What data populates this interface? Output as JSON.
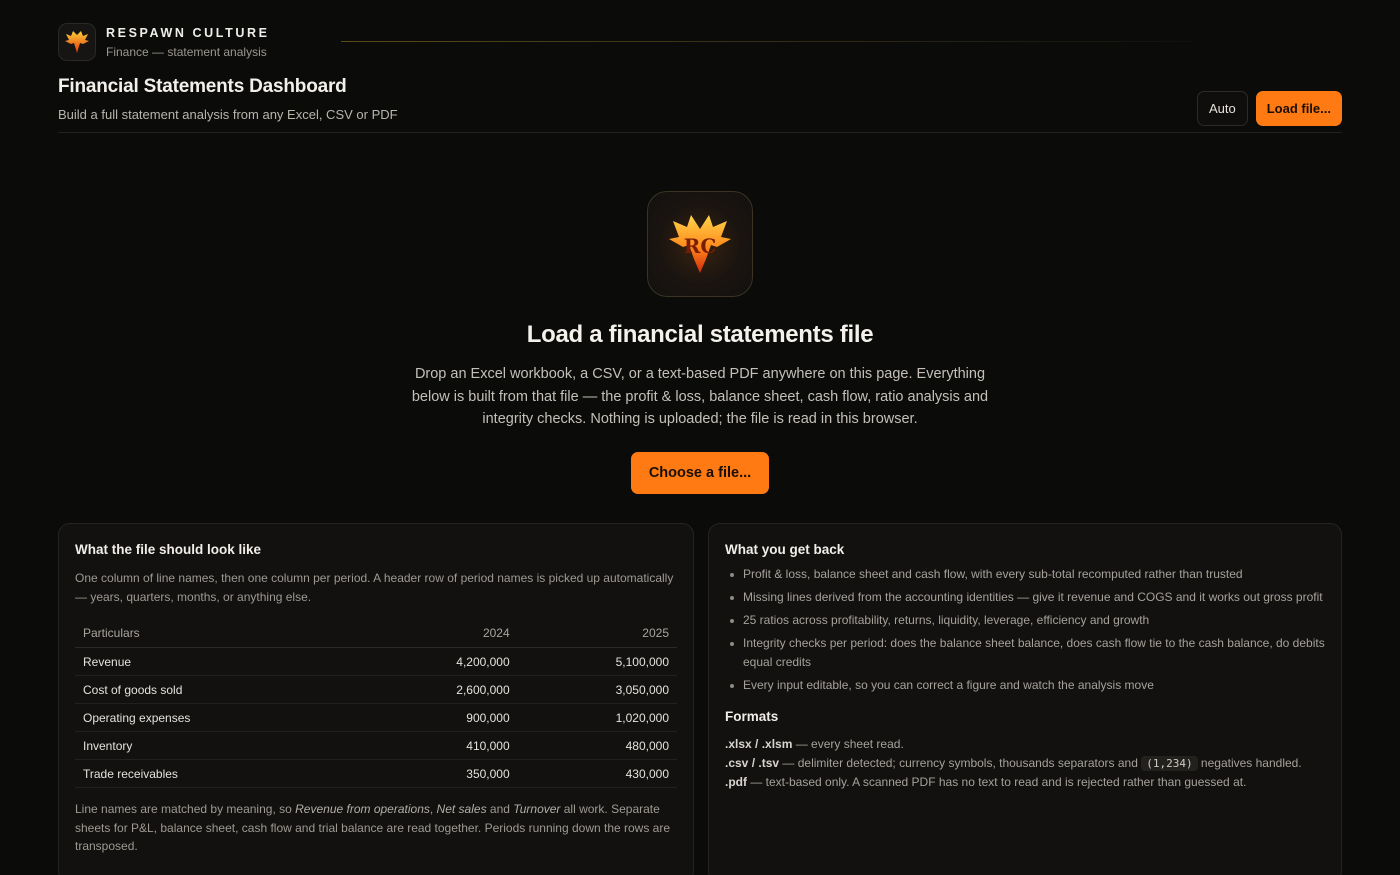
{
  "brand": {
    "name": "RESPAWN CULTURE",
    "subtitle": "Finance — statement analysis",
    "logo_icon": "phoenix-logo-icon"
  },
  "header": {
    "title": "Financial Statements Dashboard",
    "subtitle": "Build a full statement analysis from any Excel, CSV or PDF",
    "theme_button": "Auto",
    "load_button": "Load file..."
  },
  "hero": {
    "icon": "phoenix-rc-icon",
    "title": "Load a financial statements file",
    "text": "Drop an Excel workbook, a CSV, or a text-based PDF anywhere on this page. Everything below is built from that file — the profit & loss, balance sheet, cash flow, ratio analysis and integrity checks. Nothing is uploaded; the file is read in this browser.",
    "choose_button": "Choose a file..."
  },
  "left_card": {
    "title": "What the file should look like",
    "intro": "One column of line names, then one column per period. A header row of period names is picked up automatically — years, quarters, months, or anything else.",
    "columns": [
      "Particulars",
      "2024",
      "2025"
    ],
    "rows": [
      [
        "Revenue",
        "4,200,000",
        "5,100,000"
      ],
      [
        "Cost of goods sold",
        "2,600,000",
        "3,050,000"
      ],
      [
        "Operating expenses",
        "900,000",
        "1,020,000"
      ],
      [
        "Inventory",
        "410,000",
        "480,000"
      ],
      [
        "Trade receivables",
        "350,000",
        "430,000"
      ]
    ],
    "outro_pre": "Line names are matched by meaning, so ",
    "outro_ex1": "Revenue from operations",
    "outro_sep1": ", ",
    "outro_ex2": "Net sales",
    "outro_sep2": " and ",
    "outro_ex3": "Turnover",
    "outro_post": " all work. Separate sheets for P&L, balance sheet, cash flow and trial balance are read together. Periods running down the rows are transposed."
  },
  "right_card": {
    "title": "What you get back",
    "features": [
      "Profit & loss, balance sheet and cash flow, with every sub-total recomputed rather than trusted",
      "Missing lines derived from the accounting identities — give it revenue and COGS and it works out gross profit",
      "25 ratios across profitability, returns, liquidity, leverage, efficiency and growth",
      "Integrity checks per period: does the balance sheet balance, does cash flow tie to the cash balance, do debits equal credits",
      "Every input editable, so you can correct a figure and watch the analysis move"
    ],
    "formats_title": "Formats",
    "formats": {
      "xlsx_name": ".xlsx / .xlsm",
      "xlsx_desc": " — every sheet read.",
      "csv_name": ".csv / .tsv",
      "csv_desc_pre": " — delimiter detected; currency symbols, thousands separators and ",
      "csv_code": "(1,234)",
      "csv_desc_post": " negatives handled.",
      "pdf_name": ".pdf",
      "pdf_desc": " — text-based only. A scanned PDF has no text to read and is rejected rather than guessed at."
    }
  },
  "colors": {
    "accent": "#ff7a12",
    "background": "#0b0b0a",
    "card": "#121110"
  }
}
